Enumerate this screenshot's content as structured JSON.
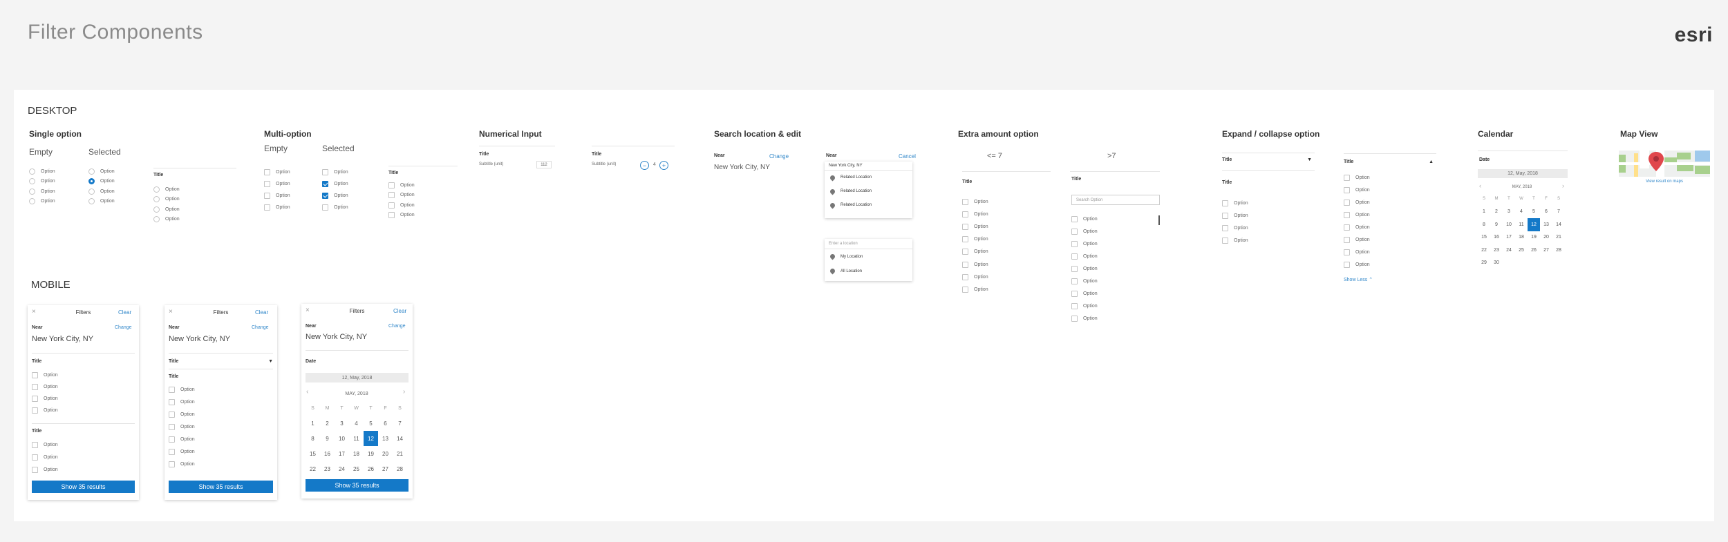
{
  "page": {
    "title": "Filter Components",
    "logo": "esri"
  },
  "desktop": {
    "label": "DESKTOP",
    "single": {
      "title": "Single option",
      "empty": "Empty",
      "selected": "Selected",
      "list_title": "Title",
      "option": "Option"
    },
    "multi": {
      "title": "Multi-option",
      "empty": "Empty",
      "selected": "Selected",
      "list_title": "Title",
      "option": "Option"
    },
    "numerical": {
      "title": "Numerical Input",
      "field_title": "Title",
      "subtitle": "Subtitle (unit)",
      "value": "112",
      "stepper_value": "4",
      "minus": "−",
      "plus": "+"
    },
    "search": {
      "title": "Search location & edit",
      "near": "Near",
      "change": "Change",
      "location": "New York City, NY",
      "cancel": "Cancel",
      "input_value": "New York City, NY",
      "related": [
        "Related Location",
        "Related Location",
        "Related Location"
      ],
      "enter_placeholder": "Enter a location",
      "my_location": "My Location",
      "all_location": "All Location"
    },
    "extra": {
      "title": "Extra amount option",
      "le": "<= 7",
      "gt": ">7",
      "list_title": "Title",
      "search_placeholder": "Search Option",
      "option": "Option"
    },
    "expand": {
      "title": "Expand / collapse option",
      "list_title": "Title",
      "option": "Option",
      "show_less": "Show Less"
    },
    "calendar": {
      "title": "Calendar",
      "date_label": "Date",
      "date_value": "12, May, 2018",
      "month": "MAY, 2018",
      "dow": [
        "S",
        "M",
        "T",
        "W",
        "T",
        "F",
        "S"
      ],
      "days": [
        "1",
        "2",
        "3",
        "4",
        "5",
        "6",
        "7",
        "8",
        "9",
        "10",
        "11",
        "12",
        "13",
        "14",
        "15",
        "16",
        "17",
        "18",
        "19",
        "20",
        "21",
        "22",
        "23",
        "24",
        "25",
        "26",
        "27",
        "28",
        "29",
        "30"
      ]
    },
    "map": {
      "title": "Map View",
      "link": "View result on maps"
    }
  },
  "mobile": {
    "label": "MOBILE",
    "close": "×",
    "filters": "Filters",
    "clear": "Clear",
    "near": "Near",
    "change": "Change",
    "location": "New York City, NY",
    "title": "Title",
    "option": "Option",
    "date": "Date",
    "date_value": "12, May, 2018",
    "month": "MAY, 2018",
    "show": "Show 35 results"
  },
  "colors": {
    "accent": "#1479c8",
    "link": "#2f86c9",
    "pin": "#e0474c"
  }
}
